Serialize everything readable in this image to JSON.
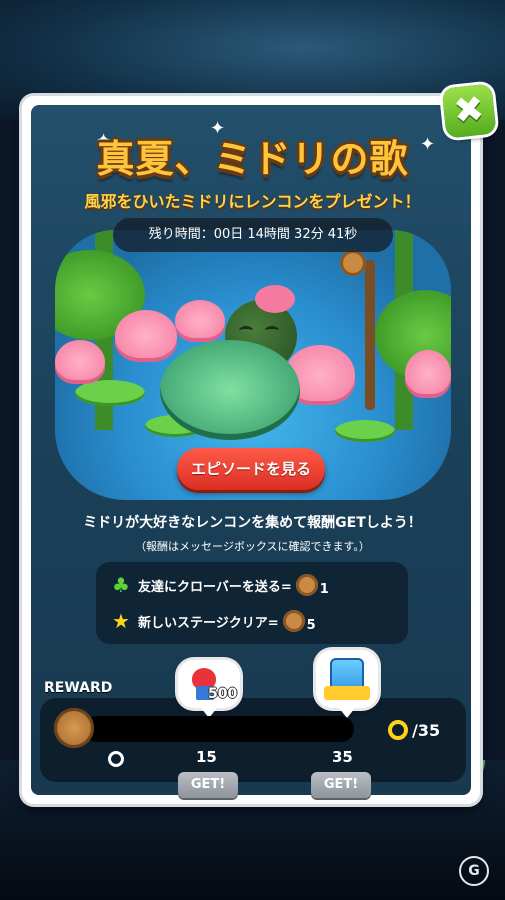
{
  "event": {
    "title": "真夏、ミドリの歌",
    "subtitle": "風邪をひいたミドリにレンコンをプレゼント！",
    "timer_text": "残り時間：00日 14時間 32分 41秒",
    "episode_button": "エピソードを見る",
    "description": "ミドリが大好きなレンコンを集めて報酬GETしよう！",
    "note": "（報酬はメッセージボックスに確認できます。）"
  },
  "missions": [
    {
      "icon": "clover-icon",
      "text": "友達にクローバーを送る=",
      "reward": "1"
    },
    {
      "icon": "star-icon",
      "text": "新しいステージクリア=",
      "reward": "5"
    }
  ],
  "reward": {
    "label": "REWARD",
    "progress_fraction": 0.0,
    "milestones": [
      "0",
      "15",
      "35"
    ],
    "get_labels": [
      "GET!",
      "GET!"
    ],
    "bubble_amount": "500",
    "count_value": "/35"
  },
  "close_symbol": "✖",
  "watermark": "G",
  "colors": {
    "title": "#ffc53a",
    "subtitle": "#ffd44a",
    "accent_green": "#55ad1f",
    "episode_red": "#d92f22"
  }
}
